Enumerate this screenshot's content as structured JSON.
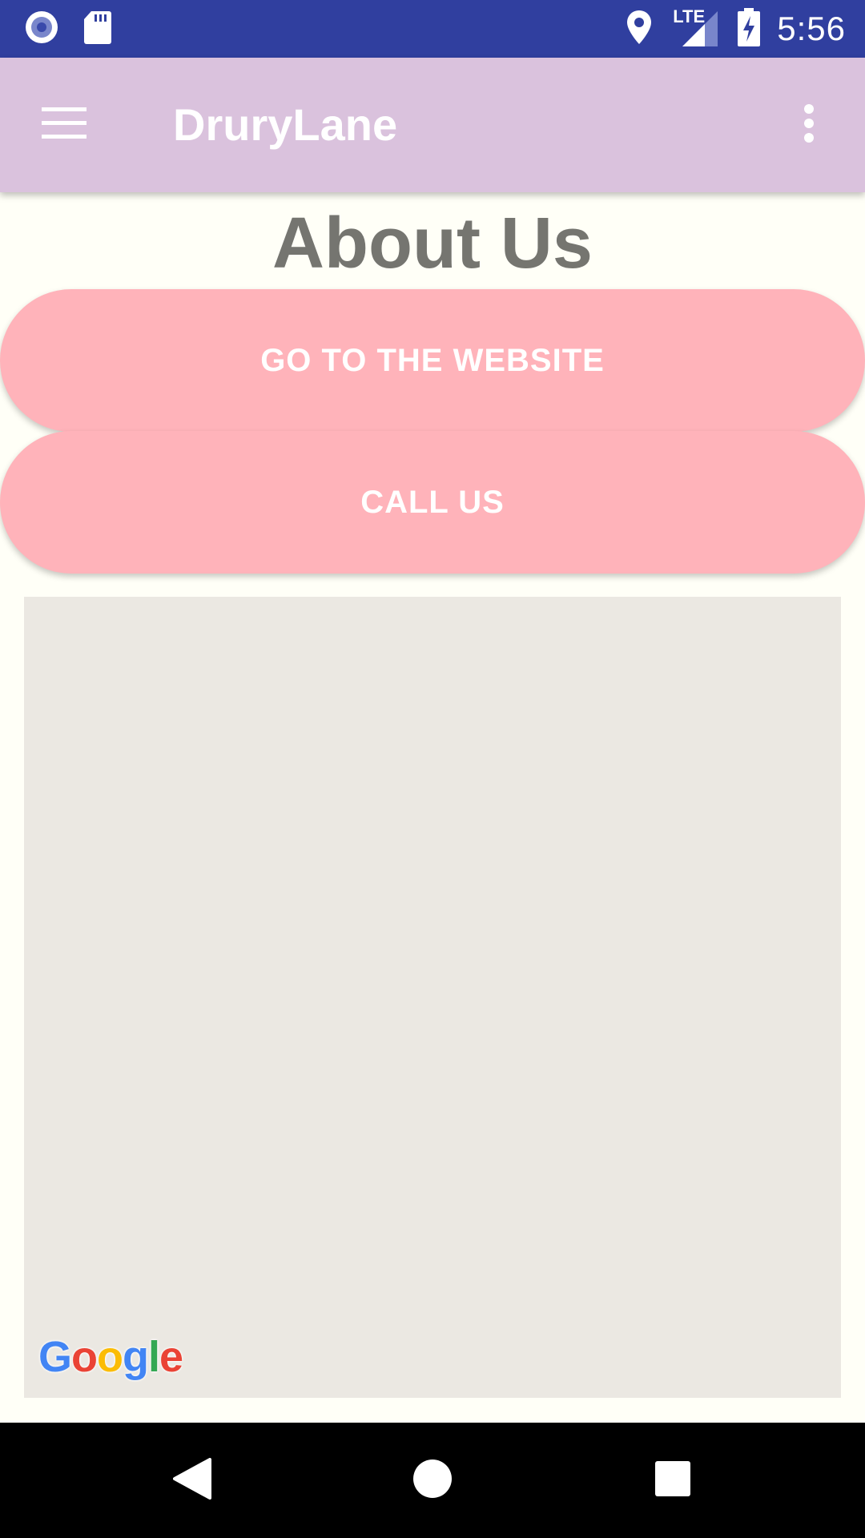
{
  "status_bar": {
    "time": "5:56",
    "network_label": "LTE",
    "icons": [
      "record-icon",
      "sd-card-icon",
      "location-icon",
      "signal-icon",
      "battery-charging-icon"
    ]
  },
  "app_bar": {
    "title": "DruryLane",
    "background_color": "#dac2dd",
    "icons": [
      "menu-icon",
      "more-vert-icon"
    ]
  },
  "main": {
    "heading": "About Us",
    "buttons": {
      "website_label": "GO TO THE WEBSITE",
      "call_label": "CALL US"
    },
    "button_color": "#ffb3ba",
    "map": {
      "logo_text": "Google"
    }
  },
  "nav_bar": {
    "icons": [
      "back-icon",
      "home-icon",
      "recents-icon"
    ]
  },
  "colors": {
    "status_bar": "#303f9f",
    "page_background": "#fffff7",
    "heading_text": "#757570",
    "map_background": "#ebe8e2"
  }
}
